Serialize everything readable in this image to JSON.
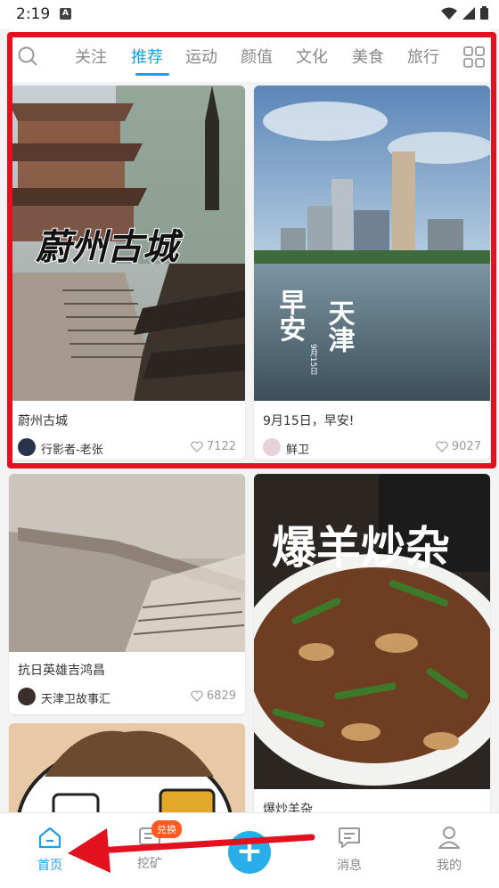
{
  "status": {
    "time": "2:19"
  },
  "tabs": [
    "关注",
    "推荐",
    "运动",
    "颜值",
    "文化",
    "美食",
    "旅行"
  ],
  "active_tab": "推荐",
  "cards": [
    {
      "title": "蔚州古城",
      "overlay": "蔚州古城",
      "author": "行影者-老张",
      "likes": "7122"
    },
    {
      "title": "9月15日，早安!",
      "overlay1": "早安",
      "overlay2": "天津",
      "overlay_date": "9月15日",
      "author": "鲜卫",
      "likes": "9027"
    },
    {
      "title": "抗日英雄吉鸿昌",
      "author": "天津卫故事汇",
      "likes": "6829"
    },
    {
      "title": "爆炒羊杂",
      "overlay": "爆羊炒杂"
    }
  ],
  "bottom_nav": {
    "home": "首页",
    "mine_tab": "挖矿",
    "badge": "兑换",
    "messages": "消息",
    "me": "我的"
  },
  "colors": {
    "accent": "#1aa0e8",
    "highlight": "#e3101e"
  }
}
